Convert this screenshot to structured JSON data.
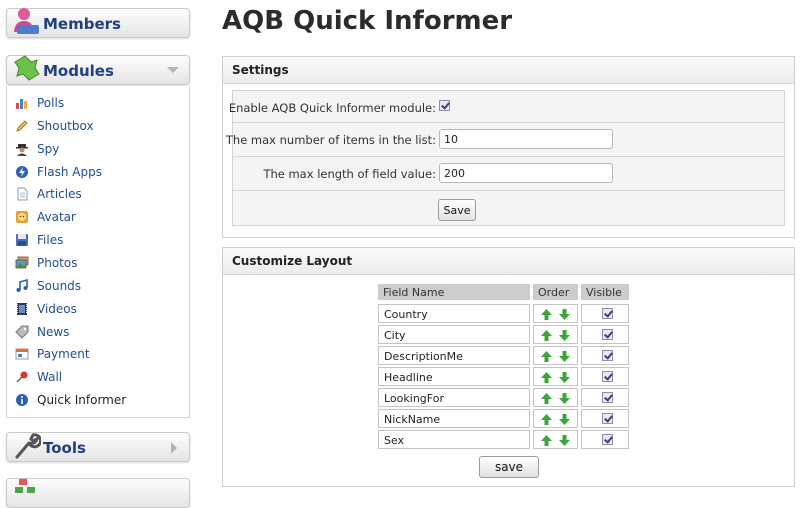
{
  "sidebar": {
    "members_label": "Members",
    "modules_label": "Modules",
    "tools_label": "Tools",
    "items": [
      {
        "label": "Polls",
        "icon": "poll-chart-icon"
      },
      {
        "label": "Shoutbox",
        "icon": "pencil-icon"
      },
      {
        "label": "Spy",
        "icon": "spy-icon"
      },
      {
        "label": "Flash Apps",
        "icon": "flash-icon"
      },
      {
        "label": "Articles",
        "icon": "document-icon"
      },
      {
        "label": "Avatar",
        "icon": "avatar-face-icon"
      },
      {
        "label": "Files",
        "icon": "floppy-disk-icon"
      },
      {
        "label": "Photos",
        "icon": "photos-icon"
      },
      {
        "label": "Sounds",
        "icon": "music-note-icon"
      },
      {
        "label": "Videos",
        "icon": "film-icon"
      },
      {
        "label": "News",
        "icon": "news-tag-icon"
      },
      {
        "label": "Payment",
        "icon": "payment-icon"
      },
      {
        "label": "Wall",
        "icon": "pin-icon"
      },
      {
        "label": "Quick Informer",
        "icon": "info-icon"
      }
    ]
  },
  "page": {
    "title": "AQB Quick Informer"
  },
  "settings": {
    "title": "Settings",
    "enable_label": "Enable AQB Quick Informer module:",
    "enable_checked": true,
    "max_items_label": "The max number of items in the list:",
    "max_items_value": "10",
    "max_length_label": "The max length of field value:",
    "max_length_value": "200",
    "save_label": "Save"
  },
  "layout": {
    "title": "Customize Layout",
    "headers": {
      "field": "Field Name",
      "order": "Order",
      "visible": "Visible"
    },
    "rows": [
      {
        "field": "Country",
        "visible": true
      },
      {
        "field": "City",
        "visible": true
      },
      {
        "field": "DescriptionMe",
        "visible": true
      },
      {
        "field": "Headline",
        "visible": true
      },
      {
        "field": "LookingFor",
        "visible": true
      },
      {
        "field": "NickName",
        "visible": true
      },
      {
        "field": "Sex",
        "visible": true
      }
    ],
    "save_label": "save"
  },
  "colors": {
    "link": "#1f4d96",
    "header": "#213f82",
    "arrow_green": "#3aa63a"
  }
}
